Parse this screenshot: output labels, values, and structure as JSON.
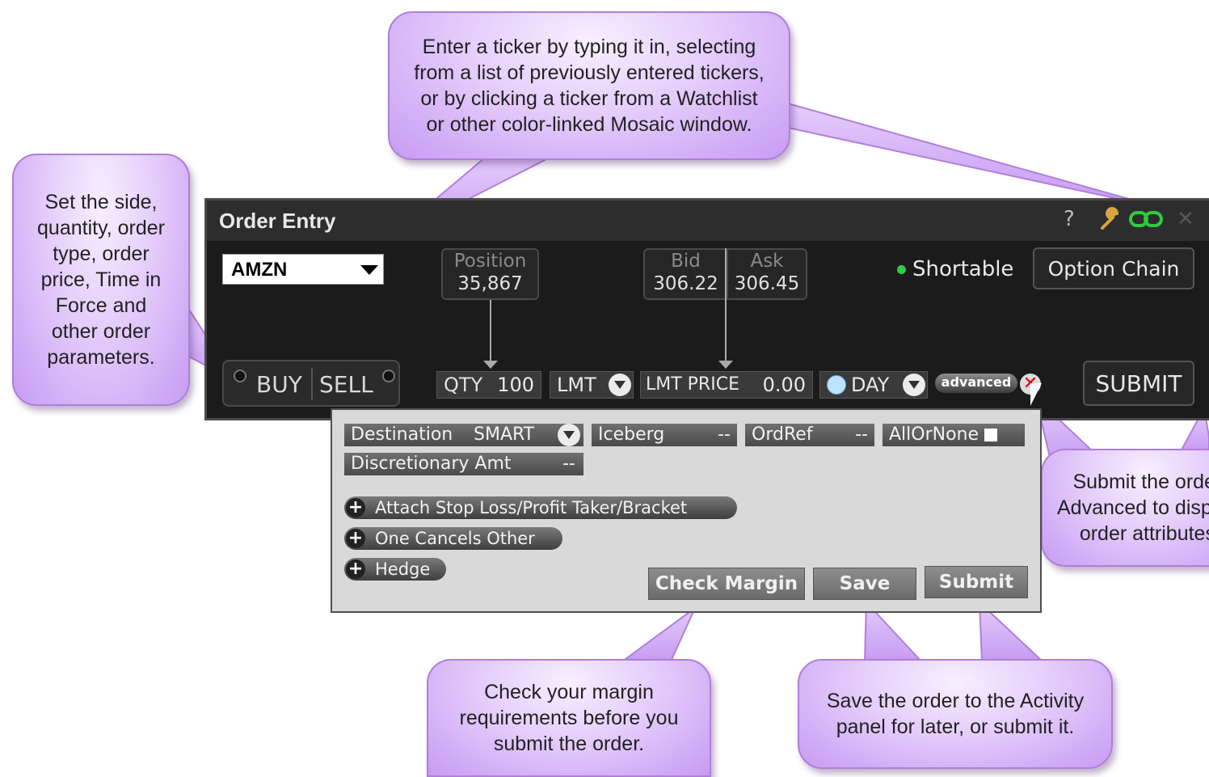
{
  "window": {
    "title": "Order Entry",
    "help_glyph": "?",
    "icons": [
      "wrench-icon",
      "link-icon",
      "close-icon"
    ],
    "link_color": "#2ecc40"
  },
  "ticker": {
    "value": "AMZN"
  },
  "position": {
    "label": "Position",
    "value": "35,867"
  },
  "bid": {
    "label": "Bid",
    "value": "306.22"
  },
  "ask": {
    "label": "Ask",
    "value": "306.45"
  },
  "shortable": {
    "label": "Shortable",
    "indicator_color": "#2ecc40"
  },
  "option_chain": {
    "label": "Option Chain"
  },
  "side": {
    "buy": "BUY",
    "sell": "SELL"
  },
  "qty": {
    "label": "QTY",
    "value": "100"
  },
  "order_type": {
    "value": "LMT"
  },
  "lmt_price": {
    "label": "LMT PRICE",
    "value": "0.00"
  },
  "tif": {
    "value": "DAY"
  },
  "advanced": {
    "label": "advanced",
    "close_glyph": "✕"
  },
  "submit": {
    "label": "SUBMIT"
  },
  "panel": {
    "destination": {
      "label": "Destination",
      "value": "SMART"
    },
    "iceberg": {
      "label": "Iceberg",
      "value": "--"
    },
    "ordref": {
      "label": "OrdRef",
      "value": "--"
    },
    "allornone": {
      "label": "AllOrNone"
    },
    "discretionary": {
      "label": "Discretionary Amt",
      "value": "--"
    },
    "attach": "Attach Stop Loss/Profit Taker/Bracket",
    "oco": "One Cancels Other",
    "hedge": "Hedge",
    "check_margin": "Check Margin",
    "save": "Save",
    "submit": "Submit"
  },
  "callouts": {
    "ticker": [
      "Enter a ticker by typing it in, selecting",
      "from a list of previously entered tickers,",
      "or by clicking a ticker from a Watchlist",
      "or other color-linked Mosaic window."
    ],
    "side": [
      "Set the side,",
      "quantity, order",
      "type, order",
      "price, Time in",
      "Force and",
      "other order",
      "parameters."
    ],
    "submit": [
      "Submit the order",
      "Advanced to display",
      "order attributes"
    ],
    "margin": [
      "Check your margin",
      "requirements before you",
      "submit the order."
    ],
    "save": [
      "Save the order to the Activity",
      "panel for later, or submit it."
    ]
  },
  "colors": {
    "callout_fill": "#dcbcf9",
    "window_bg": "#1b1b1b",
    "panel_bg": "#d9d9d9"
  }
}
